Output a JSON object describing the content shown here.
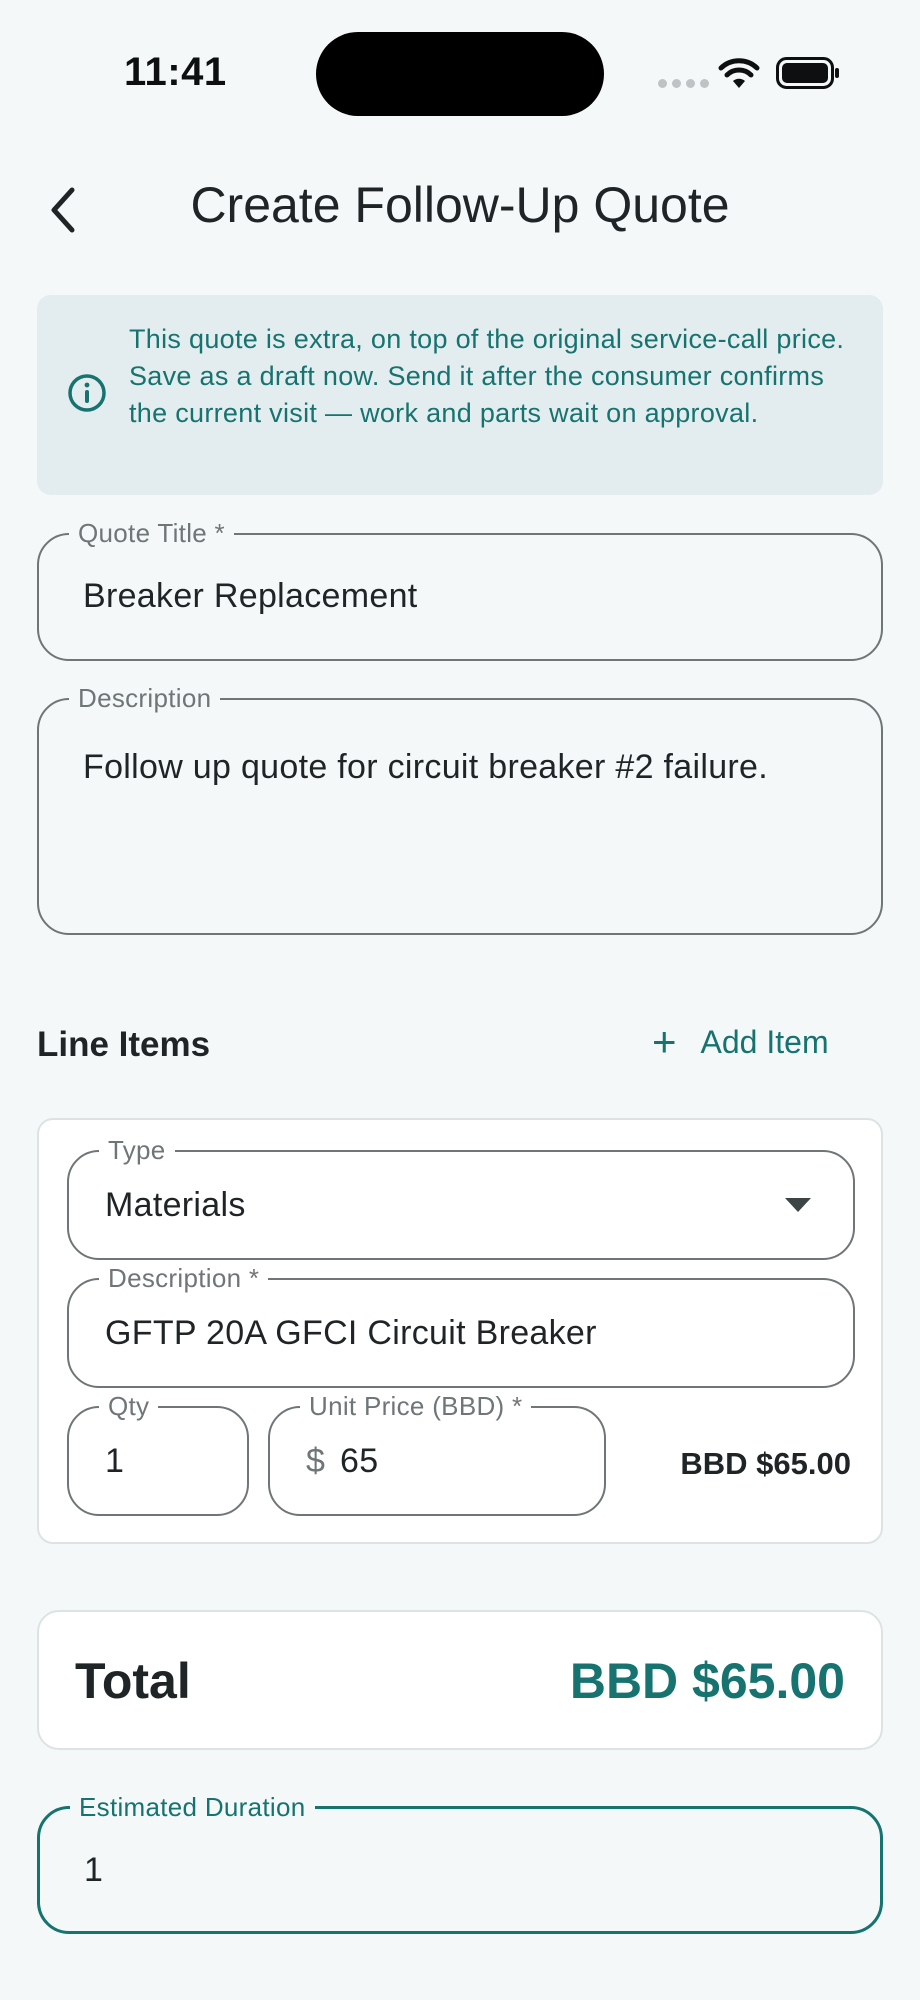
{
  "status_bar": {
    "time": "11:41"
  },
  "header": {
    "title": "Create Follow-Up Quote",
    "back_icon": "chevron-left-icon"
  },
  "info_banner": {
    "icon": "info-icon",
    "text": "This quote is extra, on top of the original service-call price. Save as a draft now. Send it after the consumer confirms the current visit — work and parts wait on approval."
  },
  "form": {
    "quote_title": {
      "label": "Quote Title *",
      "value": "Breaker Replacement"
    },
    "description": {
      "label": "Description",
      "value": "Follow up quote for circuit breaker #2 failure."
    },
    "estimated_duration": {
      "label": "Estimated Duration",
      "value": "1"
    }
  },
  "line_items": {
    "title": "Line Items",
    "add_label": "Add Item",
    "items": [
      {
        "type_label": "Type",
        "type_value": "Materials",
        "description_label": "Description *",
        "description_value": "GFTP 20A GFCI Circuit Breaker",
        "qty_label": "Qty",
        "qty_value": "1",
        "unit_price_label": "Unit Price (BBD) *",
        "currency_prefix": "$",
        "unit_price_value": "65",
        "line_total": "BBD $65.00"
      }
    ]
  },
  "total": {
    "label": "Total",
    "value": "BBD $65.00"
  },
  "colors": {
    "accent": "#16736f",
    "background": "#f4f8f9",
    "banner_bg": "#e3ecee",
    "outline": "#6f7678"
  }
}
